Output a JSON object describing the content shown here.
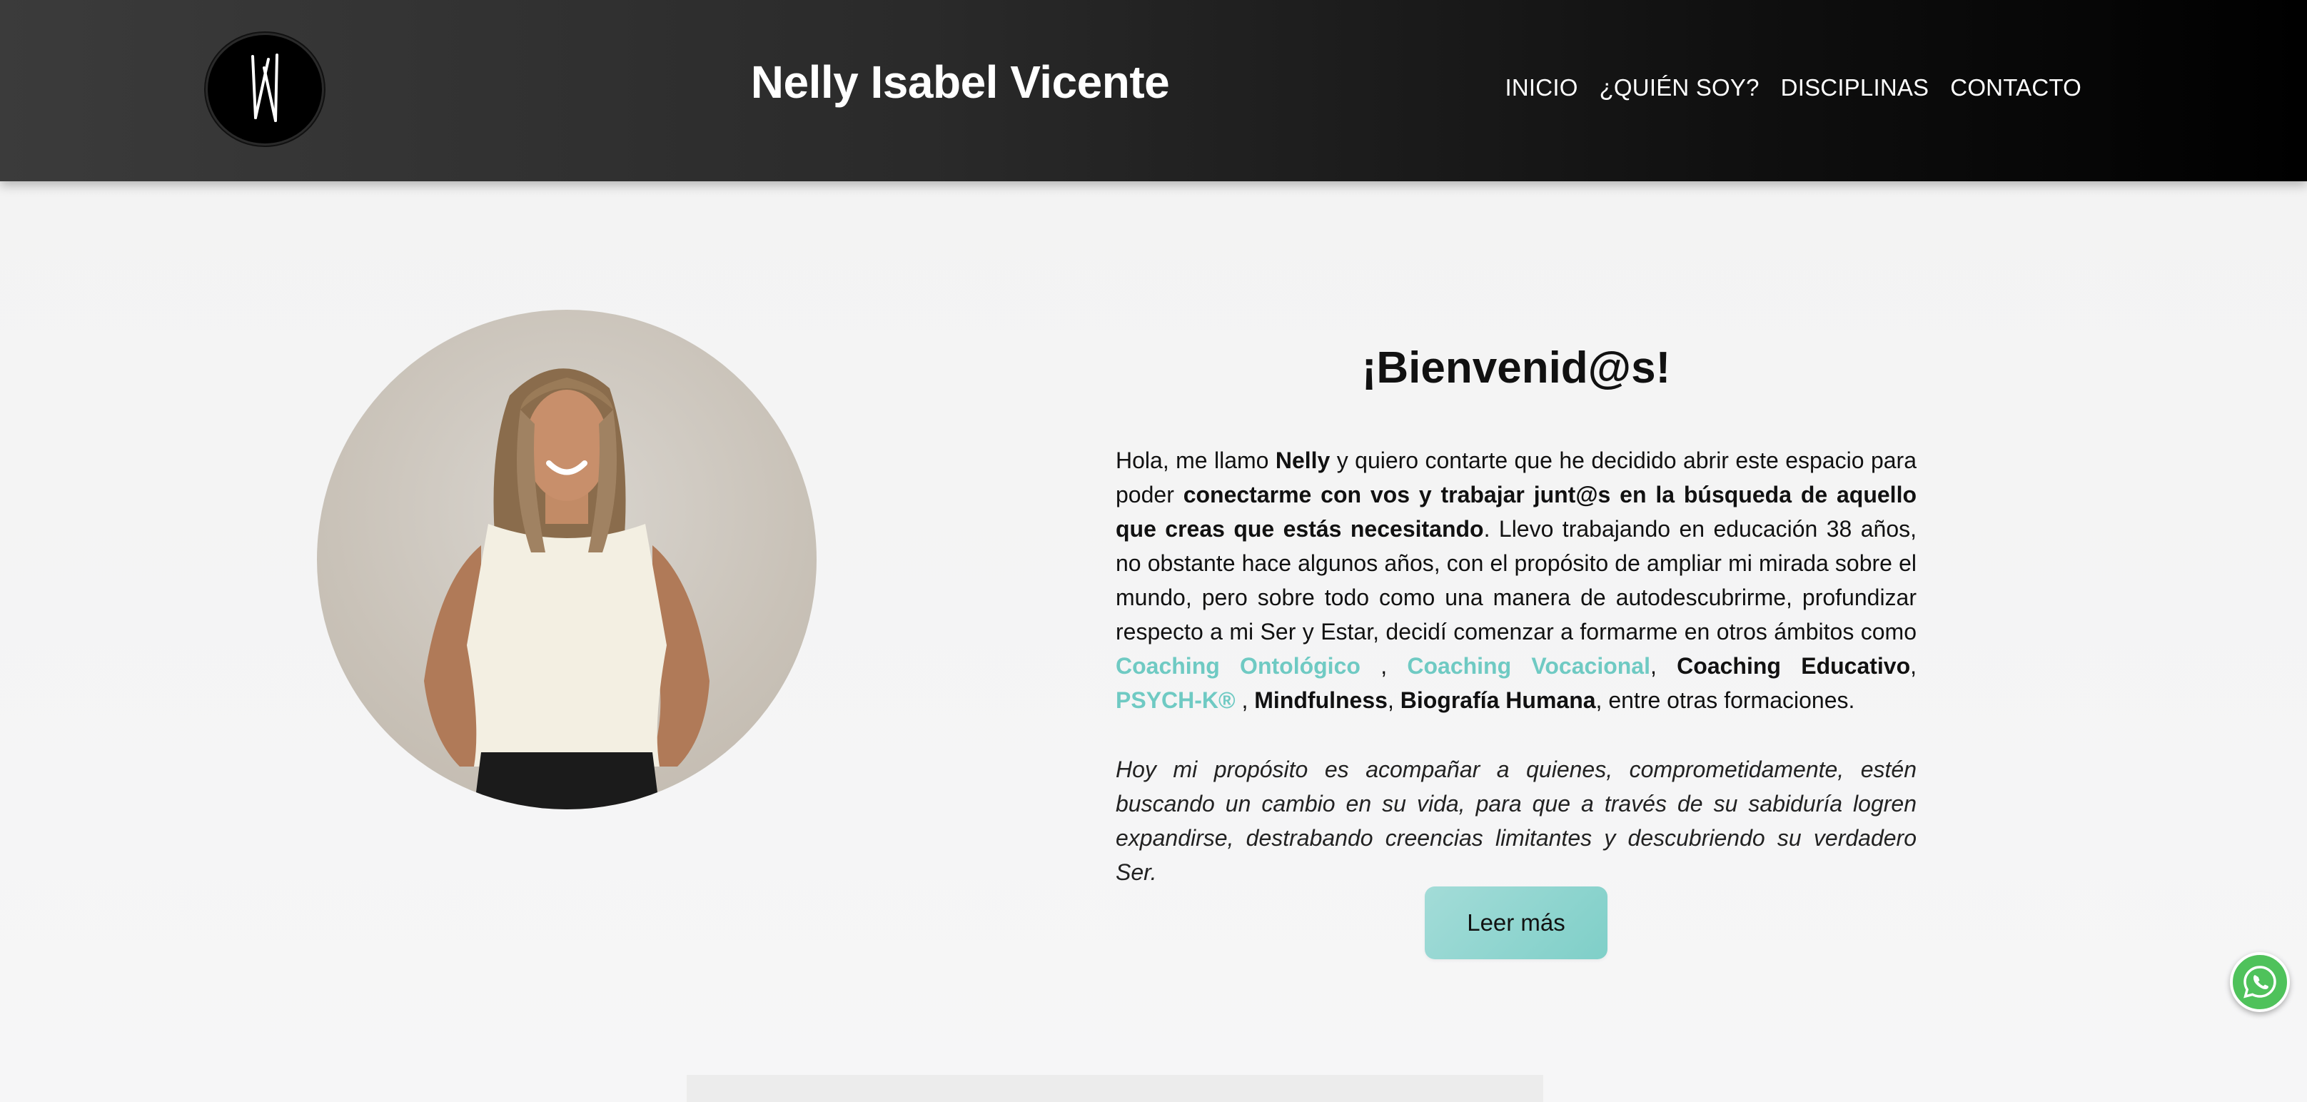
{
  "header": {
    "title": "Nelly Isabel Vicente",
    "logo_icon": "nv-monogram-logo",
    "nav": [
      {
        "label": "INICIO"
      },
      {
        "label": "¿QUIÉN SOY?"
      },
      {
        "label": "DISCIPLINAS"
      },
      {
        "label": "CONTACTO"
      }
    ]
  },
  "welcome": {
    "title": "¡Bienvenid@s!",
    "intro": {
      "t1": "Hola, me llamo ",
      "b1": "Nelly",
      "t2": " y quiero contarte que he decidido abrir este espacio para poder ",
      "b2": "conectarme con vos y trabajar junt@s en la búsqueda de aquello que creas que estás necesitando",
      "t3": ". Llevo trabajando en educación 38 años, no obstante hace algunos años, con el propósito de ampliar mi mirada sobre el mundo, pero sobre todo como una manera de autodescubrirme, profundizar respecto a mi Ser y Estar, decidí comenzar a formarme en otros ámbitos como ",
      "link1": "Coaching Ontológico",
      "t4": " , ",
      "link2": "Coaching Vocacional",
      "t5": ", ",
      "b3": "Coaching Educativo",
      "t6": ", ",
      "link3": "PSYCH-K®",
      "t7": " , ",
      "b4": "Mindfulness",
      "t8": ", ",
      "b5": "Biografía Humana",
      "t9": ", entre otras formaciones."
    },
    "purpose": "Hoy mi propósito es acompañar a quienes, comprometidamente, estén buscando un cambio en su vida, para que a través de su sabiduría logren expandirse, destrabando creencias limitantes y descubriendo su verdadero Ser.",
    "button_label": "Leer más"
  },
  "colors": {
    "accent": "#6fcac3",
    "button": "#8fd5cf",
    "whatsapp": "#4fc25b",
    "header_dark": "#000000"
  },
  "icons": {
    "whatsapp": "whatsapp-icon",
    "portrait": "profile-photo"
  }
}
